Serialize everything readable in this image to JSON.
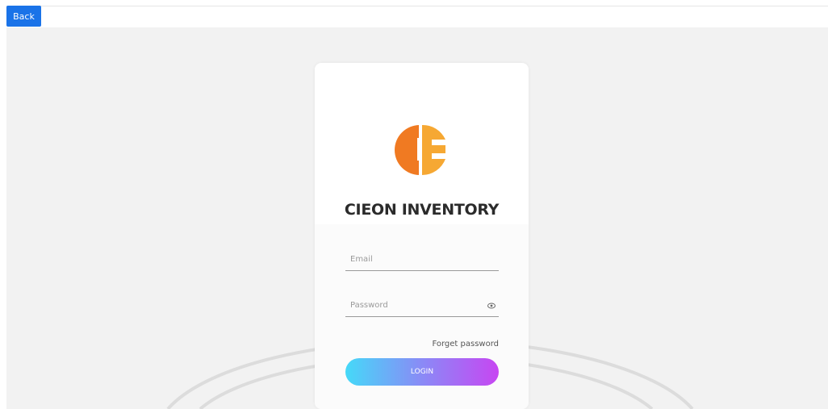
{
  "nav": {
    "back_label": "Back"
  },
  "login": {
    "title": "CIEON INVENTORY",
    "email_placeholder": "Email",
    "password_placeholder": "Password",
    "forget_label": "Forget password",
    "login_label": "LOGIN"
  },
  "colors": {
    "back_button": "#1a73e8",
    "logo_dark_orange": "#f07a22",
    "logo_light_orange": "#f6a833",
    "login_gradient_start": "#45d9f8",
    "login_gradient_end": "#c746f2",
    "page_background": "#f2f2f2"
  },
  "icons": {
    "password_visibility": "eye-icon"
  }
}
